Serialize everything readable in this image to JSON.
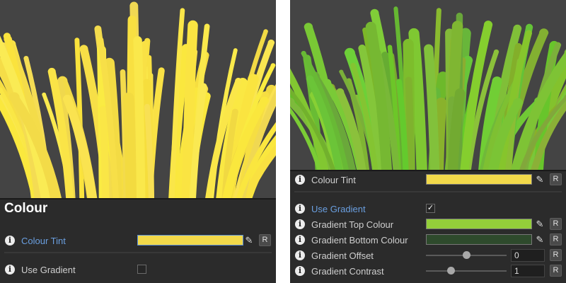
{
  "left": {
    "heading": "Colour",
    "colour_tint": {
      "label": "Colour Tint",
      "color": "#f2d94a",
      "reset": "R"
    },
    "use_gradient": {
      "label": "Use Gradient",
      "checked": false
    }
  },
  "right": {
    "colour_tint": {
      "label": "Colour Tint",
      "color": "#f2d94a",
      "reset": "R"
    },
    "use_gradient": {
      "label": "Use Gradient",
      "checked": true,
      "check_glyph": "✓"
    },
    "gradient_top": {
      "label": "Gradient Top Colour",
      "color": "#94cf3a",
      "reset": "R"
    },
    "gradient_bottom": {
      "label": "Gradient Bottom Colour",
      "color": "#2e4a2c",
      "reset": "R"
    },
    "gradient_offset": {
      "label": "Gradient Offset",
      "value": "0",
      "level": 0.5,
      "reset": "R"
    },
    "gradient_contrast": {
      "label": "Gradient Contrast",
      "value": "1",
      "level": 0.31,
      "reset": "R"
    }
  },
  "icons": {
    "info": "i",
    "picker": "✎"
  },
  "colors": {
    "viewport_bg": "#444444",
    "panel_bg": "#2b2b2b",
    "accent_blue": "#6a9fe0",
    "grass_yellow": "#f3dc4e"
  }
}
